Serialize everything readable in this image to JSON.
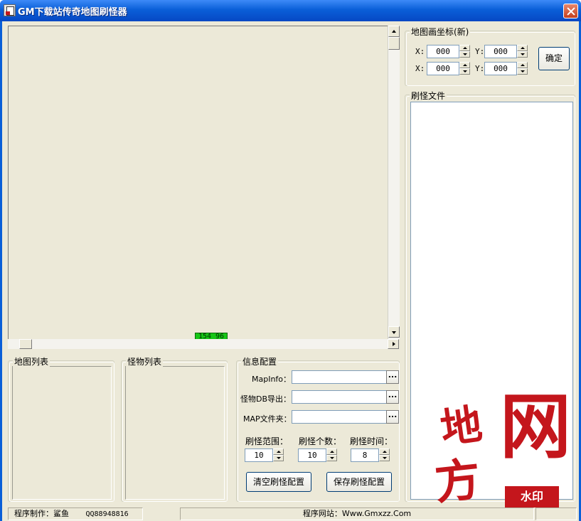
{
  "window": {
    "title": "GM下载站传奇地图刷怪器"
  },
  "map": {
    "coord_readout": "154 96"
  },
  "coord_group": {
    "legend": "地图画坐标(新)",
    "row1": {
      "x_label": "X:",
      "x_value": "000",
      "y_label": "Y:",
      "y_value": "000"
    },
    "row2": {
      "x_label": "X:",
      "x_value": "000",
      "y_label": "Y:",
      "y_value": "000"
    },
    "confirm_label": "确定"
  },
  "spawn_file_group": {
    "legend": "刷怪文件"
  },
  "map_list": {
    "legend": "地图列表"
  },
  "monster_list": {
    "legend": "怪物列表"
  },
  "info_group": {
    "legend": "信息配置",
    "mapinfo_label": "MapInfo：",
    "monster_db_label": "怪物DB导出：",
    "map_folder_label": "MAP文件夹：",
    "browse_label": "...",
    "range_label": "刷怪范围：",
    "range_value": "10",
    "count_label": "刷怪个数：",
    "count_value": "10",
    "time_label": "刷怪时间：",
    "time_value": "8",
    "clear_button": "清空刷怪配置",
    "save_button": "保存刷怪配置"
  },
  "status": {
    "author": "程序制作：鲨鱼",
    "qq": "QQ88948816",
    "website": "程序网站：Www.Gmxzz.Com"
  },
  "watermark": {
    "chars": [
      "地",
      "网",
      "方"
    ],
    "stamp": "水印"
  },
  "colors": {
    "titlebar": "#0a5fd8",
    "client_bg": "#ece9d8",
    "coord_badge": "#16c616",
    "watermark": "#c4161c"
  }
}
